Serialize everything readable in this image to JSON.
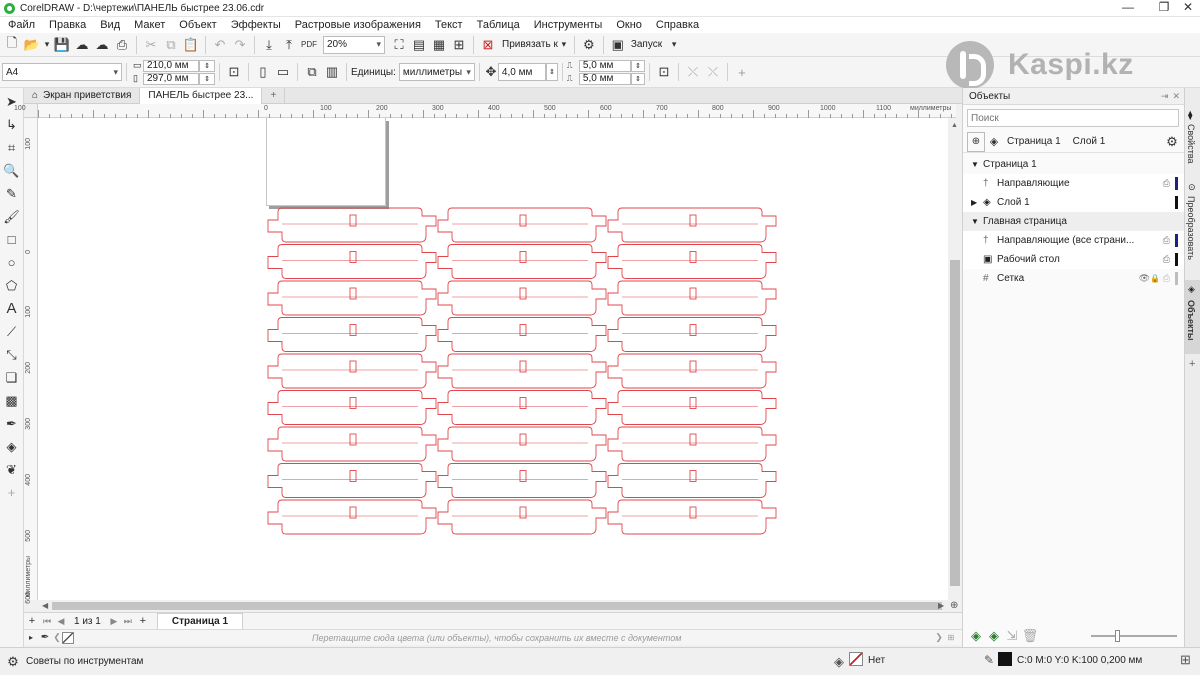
{
  "window": {
    "title": "CorelDRAW - D:\\чертежи\\ПАНЕЛЬ быстрее 23.06.cdr",
    "controls": {
      "minimize": "—",
      "restore": "❐",
      "close": "✕"
    }
  },
  "menu": [
    "Файл",
    "Правка",
    "Вид",
    "Макет",
    "Объект",
    "Эффекты",
    "Растровые изображения",
    "Текст",
    "Таблица",
    "Инструменты",
    "Окно",
    "Справка"
  ],
  "toolbar": {
    "zoom": "20%",
    "snap_label": "Привязать к",
    "launch_label": "Запуск"
  },
  "propbar": {
    "page_size": "A4",
    "width": "210,0 мм",
    "height": "297,0 мм",
    "units_label": "Единицы:",
    "units": "миллиметры",
    "nudge": "4,0 мм",
    "dup_x": "5,0 мм",
    "dup_y": "5,0 мм"
  },
  "doc_tabs": {
    "welcome": "Экран приветствия",
    "document": "ПАНЕЛЬ быстрее 23...",
    "add": "+"
  },
  "ruler": {
    "h_labels": [
      "100",
      "0",
      "100",
      "200",
      "300",
      "400",
      "500",
      "600",
      "700",
      "800",
      "900",
      "1000",
      "1100"
    ],
    "h_unit": "миллиметры",
    "v_labels": [
      "100",
      "0",
      "100",
      "200",
      "300",
      "400",
      "500",
      "600"
    ],
    "v_unit": "миллиметры"
  },
  "canvas": {
    "grid_columns": 3,
    "grid_rows": 9,
    "part_color": "#e0474c"
  },
  "page_nav": {
    "counter": "1 из 1",
    "page_tab": "Страница 1"
  },
  "palette_hint": "Перетащите сюда цвета (или объекты), чтобы сохранить их вместе с документом",
  "status": {
    "hints": "Советы по инструментам",
    "fill": "Нет",
    "outline": "C:0 M:0 Y:0 K:100  0,200 мм"
  },
  "objects_panel": {
    "title": "Объекты",
    "search_placeholder": "Поиск",
    "page_label": "Страница 1",
    "layer_label": "Слой 1",
    "tree": [
      {
        "label": "Страница 1",
        "level": 0,
        "kind": "group"
      },
      {
        "label": "Направляющие",
        "level": 1,
        "kind": "guides",
        "color": "#1a237e"
      },
      {
        "label": "Слой 1",
        "level": 1,
        "kind": "layer",
        "color": "#111111"
      },
      {
        "label": "Главная страница",
        "level": 0,
        "kind": "group"
      },
      {
        "label": "Направляющие (все страни...",
        "level": 1,
        "kind": "guides",
        "color": "#1a237e"
      },
      {
        "label": "Рабочий стол",
        "level": 1,
        "kind": "desktop",
        "color": "#111111"
      },
      {
        "label": "Сетка",
        "level": 1,
        "kind": "grid",
        "color": "#bdbdbd"
      }
    ]
  },
  "side_tabs": [
    "Свойства",
    "Преобразовать",
    "Объекты"
  ],
  "watermark": {
    "text": "Kaspi.kz"
  }
}
